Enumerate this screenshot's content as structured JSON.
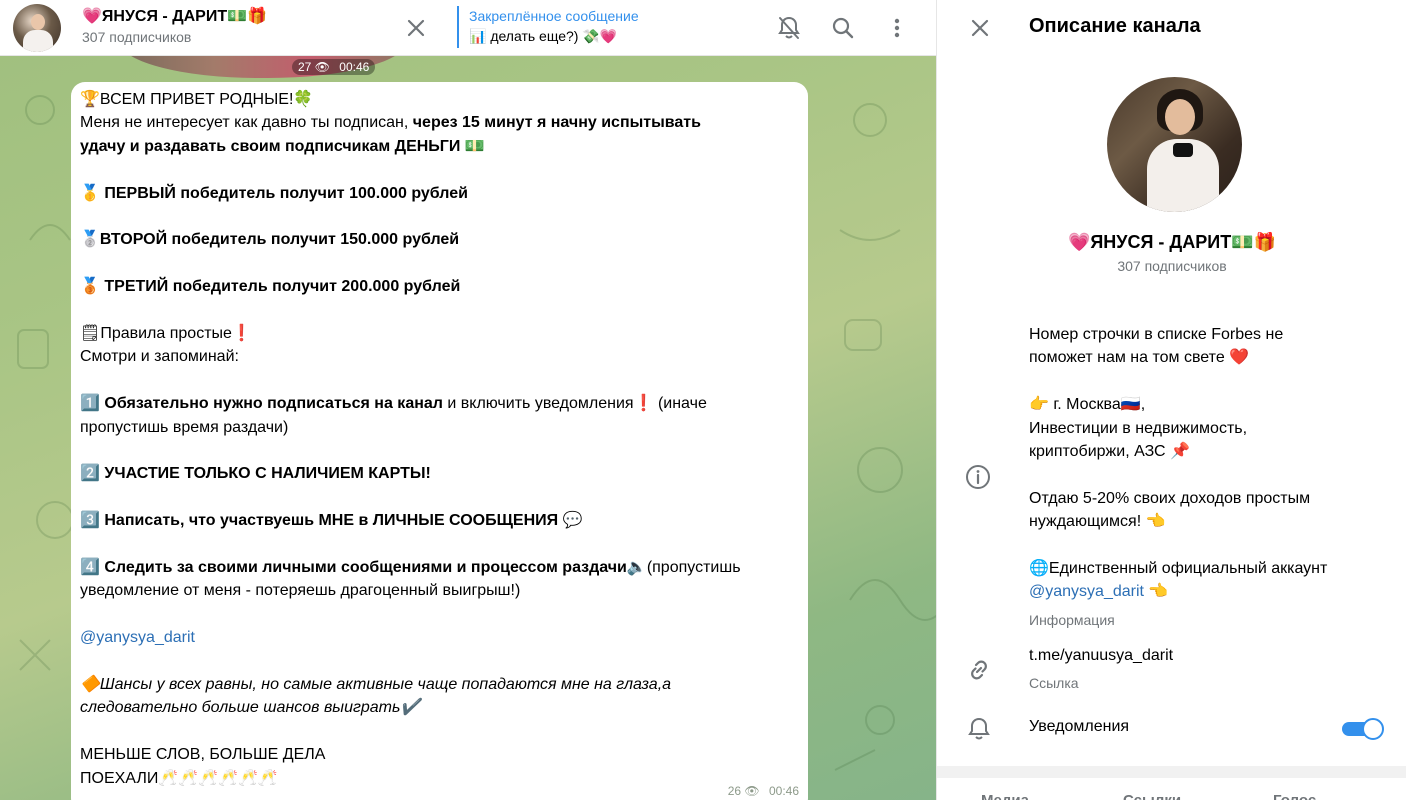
{
  "header": {
    "title": "💗ЯНУСЯ - ДАРИТ💵🎁",
    "subscribers": "307 подписчиков",
    "pinned_title": "Закреплённое сообщение",
    "pinned_text": "📊 делать еще?) 💸💗"
  },
  "photo": {
    "views": "27",
    "time": "00:46"
  },
  "message": {
    "lines": [
      {
        "t": "🏆ВСЕМ ПРИВЕТ РОДНЫЕ!🍀"
      },
      {
        "a": "Меня не интересует как давно ты подписан, ",
        "b": "через 15 минут я начну испытывать"
      },
      {
        "b": "удачу и раздавать своим подписчикам ДЕНЬГИ",
        "t": " 💵"
      },
      {
        "t": ""
      },
      {
        "b": "🥇 ПЕРВЫЙ победитель получит 100.000 рублей"
      },
      {
        "t": ""
      },
      {
        "b": "🥈ВТОРОЙ победитель получит 150.000 рублей"
      },
      {
        "t": ""
      },
      {
        "b": "🥉 ТРЕТИЙ победитель получит 200.000 рублей"
      },
      {
        "t": ""
      },
      {
        "t": "🗒Правила простые❗"
      },
      {
        "t": "Смотри и запоминай:"
      },
      {
        "t": ""
      },
      {
        "a": "1️⃣ ",
        "b": "Обязательно нужно подписаться на канал",
        "t": " и включить уведомления❗ (иначе"
      },
      {
        "t": "пропустишь время раздачи)"
      },
      {
        "t": ""
      },
      {
        "b": "2️⃣ УЧАСТИЕ ТОЛЬКО С НАЛИЧИЕМ КАРТЫ!"
      },
      {
        "t": ""
      },
      {
        "b": "3️⃣ Написать, что участвуешь МНЕ в ЛИЧНЫЕ СООБЩЕНИЯ",
        "t": " 💬"
      },
      {
        "t": ""
      },
      {
        "b": "4️⃣ Следить за своими личными сообщениями и процессом раздачи",
        "t": "🔈(пропустишь"
      },
      {
        "t": "уведомление от меня - потеряешь драгоценный выигрыш!)"
      },
      {
        "t": ""
      },
      {
        "l": "@yanysya_darit"
      },
      {
        "t": ""
      },
      {
        "i": "🔶Шансы у всех равны, но самые активные чаще попадаются мне на глаза,а"
      },
      {
        "i": "следовательно больше шансов выиграть✔️"
      },
      {
        "t": ""
      },
      {
        "t": "МЕНЬШЕ СЛОВ, БОЛЬШЕ ДЕЛА"
      },
      {
        "t": "ПОЕХАЛИ🥂🥂🥂🥂🥂🥂"
      }
    ],
    "views": "26",
    "time": "00:46"
  },
  "panel": {
    "title": "Описание канала",
    "name": "💗ЯНУСЯ - ДАРИТ💵🎁",
    "subscribers": "307 подписчиков",
    "description_lines": [
      {
        "t": "Номер строчки в списке Forbes не"
      },
      {
        "t": "поможет нам на том свете ❤️"
      },
      {
        "t": ""
      },
      {
        "t": "👉 г. Москва🇷🇺,"
      },
      {
        "t": "Инвестиции в недвижимость,"
      },
      {
        "t": "криптобиржи, АЗС 📌"
      },
      {
        "t": ""
      },
      {
        "t": "Отдаю 5-20% своих доходов простым"
      },
      {
        "t": "нуждающимся! 👈"
      },
      {
        "t": ""
      },
      {
        "t": "🌐Единственный официальный аккаунт"
      },
      {
        "l": "@yanysya_darit",
        "t": " 👈"
      }
    ],
    "description_caption": "Информация",
    "link": "t.me/yanuusya_darit",
    "link_caption": "Ссылка",
    "notifications_label": "Уведомления",
    "notifications_on": true,
    "tabs": [
      "Медиа",
      "Ссылки",
      "Голос"
    ]
  },
  "colors": {
    "accent": "#3390ec",
    "link": "#2c6fb5",
    "muted": "#707579"
  }
}
